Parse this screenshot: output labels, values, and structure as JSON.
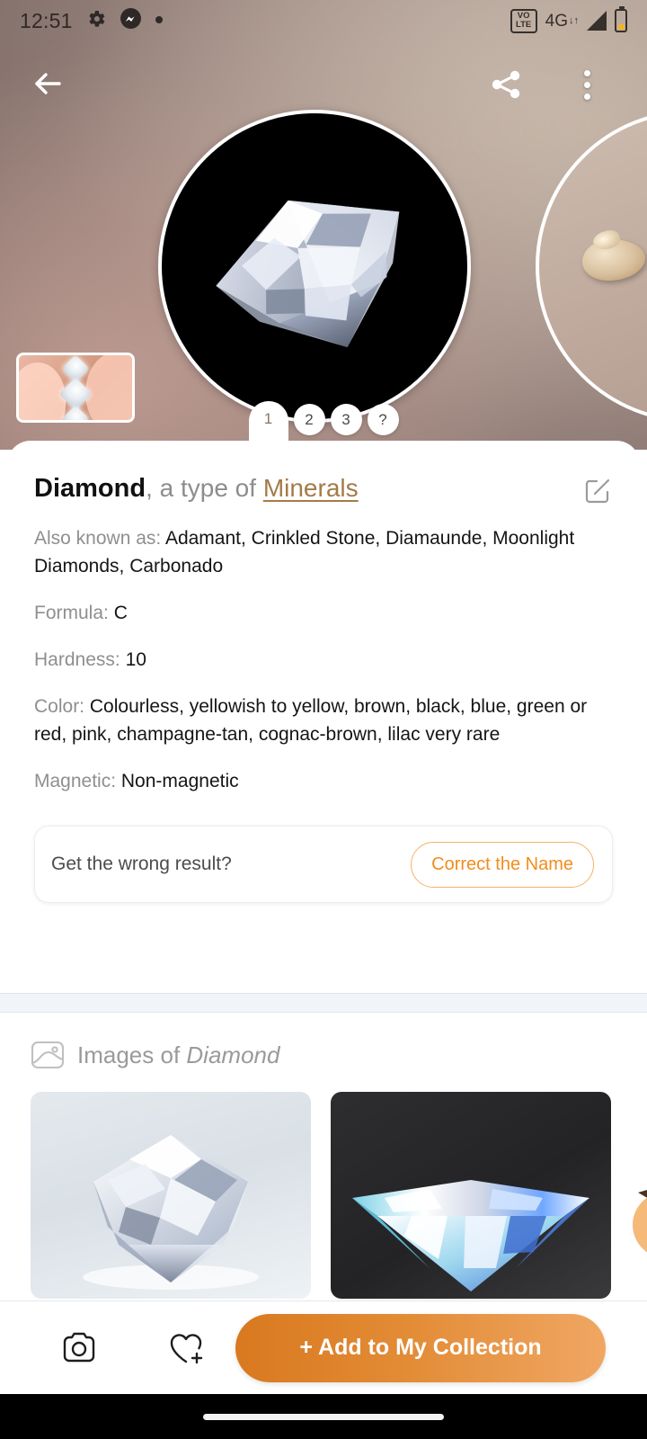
{
  "status_bar": {
    "time": "12:51",
    "icons_left": [
      "settings-gear-icon",
      "messenger-icon",
      "recording-dot-icon"
    ],
    "volte_top": "VO",
    "volte_bottom": "LTE",
    "network": "4G",
    "network_arrows": "↓↑",
    "icons_right": [
      "signal-icon",
      "battery-icon"
    ]
  },
  "top_actions": {
    "back": "back-arrow-icon",
    "share": "share-icon",
    "more": "more-options-icon"
  },
  "carousel": {
    "tabs": [
      {
        "label": "1",
        "active": true
      },
      {
        "label": "2",
        "active": false
      },
      {
        "label": "3",
        "active": false
      },
      {
        "label": "?",
        "active": false
      }
    ],
    "thumbnail_alt": "diamond-jewelry-thumbnail"
  },
  "info": {
    "name": "Diamond",
    "type_prefix": ", a type of ",
    "category": "Minerals",
    "edit_icon": "edit-icon",
    "properties": [
      {
        "label": "Also known as:",
        "value": "Adamant, Crinkled Stone, Diamaunde, Moonlight Diamonds, Carbonado"
      },
      {
        "label": "Formula:",
        "value": "C"
      },
      {
        "label": "Hardness:",
        "value": "10"
      },
      {
        "label": "Color:",
        "value": "Colourless, yellowish to yellow, brown, black, blue, green or red, pink, champagne-tan, cognac-brown, lilac very rare"
      },
      {
        "label": "Magnetic:",
        "value": "Non-magnetic"
      }
    ]
  },
  "wrong_result": {
    "question": "Get the wrong result?",
    "button_label": "Correct the Name"
  },
  "images_section": {
    "icon": "image-gallery-icon",
    "title_prefix": "Images of ",
    "title_subject": "Diamond"
  },
  "bottom_bar": {
    "camera_icon": "camera-icon",
    "favorite_icon": "heart-plus-icon",
    "add_label": "+ Add to My Collection"
  },
  "colors": {
    "accent_orange": "#e28b35",
    "category_link": "#a47b48",
    "muted_text": "#8f8f8f",
    "separator": "#f1f4f8"
  }
}
